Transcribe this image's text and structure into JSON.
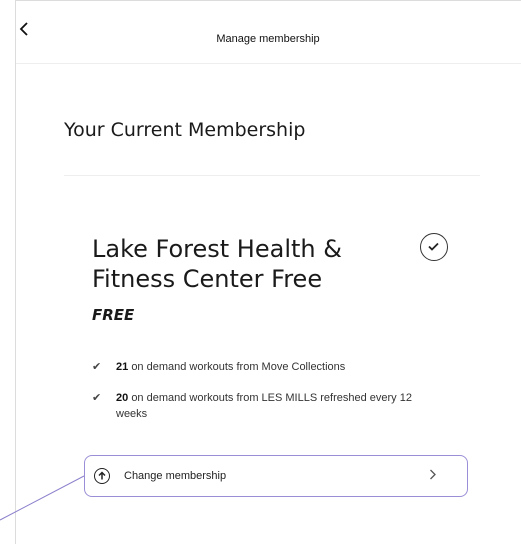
{
  "header": {
    "back_icon": "chevron-left-icon",
    "title": "Manage membership"
  },
  "section": {
    "title": "Your Current Membership"
  },
  "plan": {
    "name": "Lake Forest Health & Fitness Center Free",
    "price": "FREE",
    "selected_icon": "check-circle-icon",
    "features": [
      {
        "count": "21",
        "text": "on demand workouts from Move Collections"
      },
      {
        "count": "20",
        "text": "on demand workouts from LES MILLS refreshed every 12 weeks"
      }
    ]
  },
  "actions": {
    "change_membership_label": "Change membership",
    "change_icon": "arrow-up-circle-icon",
    "chevron_icon": "chevron-right-icon"
  },
  "colors": {
    "accent_outline": "#9a8fd6"
  }
}
